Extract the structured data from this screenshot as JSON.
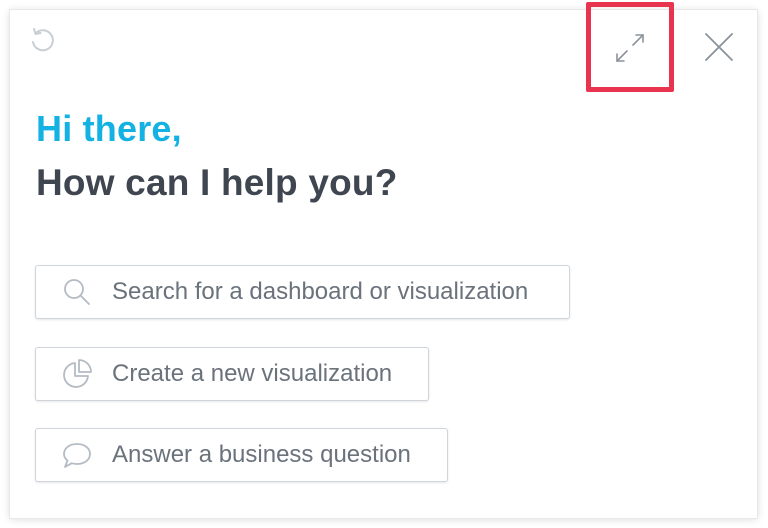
{
  "header": {
    "undo_icon": "undo-icon",
    "expand_icon": "expand-icon",
    "close_icon": "close-icon",
    "highlight_color": "#e8344e"
  },
  "greeting": {
    "line1": "Hi there,",
    "line2": "How can I help you?",
    "accent_color": "#14b2e2",
    "text_color": "#3f4650"
  },
  "actions": [
    {
      "label": "Search for a dashboard or visualization",
      "icon": "search-icon"
    },
    {
      "label": "Create a new visualization",
      "icon": "pie-chart-icon"
    },
    {
      "label": "Answer a business question",
      "icon": "speech-bubble-icon"
    }
  ]
}
